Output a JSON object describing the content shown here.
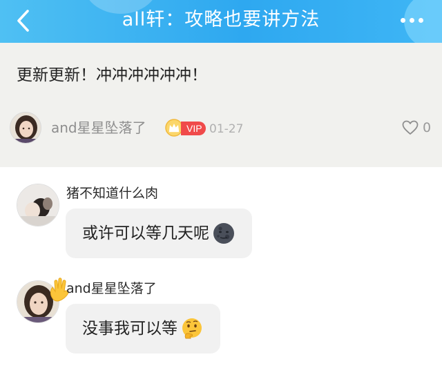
{
  "header": {
    "title": "all轩：攻略也要讲方法",
    "back_icon": "chevron-left-icon",
    "more_icon": "more-dots-icon",
    "gradient_colors": [
      "#4fc0f3",
      "#2ea8f0"
    ]
  },
  "post": {
    "content": "更新更新！冲冲冲冲冲冲！",
    "author": "and星星坠落了",
    "vip_label": "VIP",
    "date": "01-27",
    "like_count": "0",
    "like_icon": "heart-outline-icon"
  },
  "comments": [
    {
      "author": "猪不知道什么肉",
      "text": "或许可以等几天呢",
      "emoji": "new-moon-face-emoji"
    },
    {
      "author": "and星星坠落了",
      "text": "没事我可以等",
      "emoji": "thinking-face-emoji"
    }
  ],
  "colors": {
    "vip_badge": "#f04a4a",
    "post_background": "#f1f1ee",
    "comment_bubble": "#f1f1f1"
  }
}
